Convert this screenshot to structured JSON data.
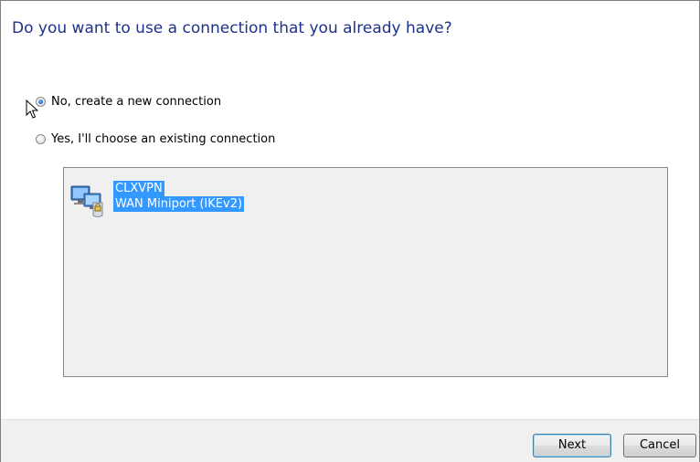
{
  "heading": "Do you want to use a connection that you already have?",
  "options": {
    "new_connection": "No, create a new connection",
    "existing_connection": "Yes, I'll choose an existing connection",
    "selected": "new_connection"
  },
  "connections": [
    {
      "name": "CLXVPN",
      "device": "WAN Miniport (IKEv2)",
      "icon": "network-connection-icon"
    }
  ],
  "buttons": {
    "next": "Next",
    "cancel": "Cancel"
  },
  "colors": {
    "heading": "#1e3287",
    "selection": "#3399ff"
  }
}
